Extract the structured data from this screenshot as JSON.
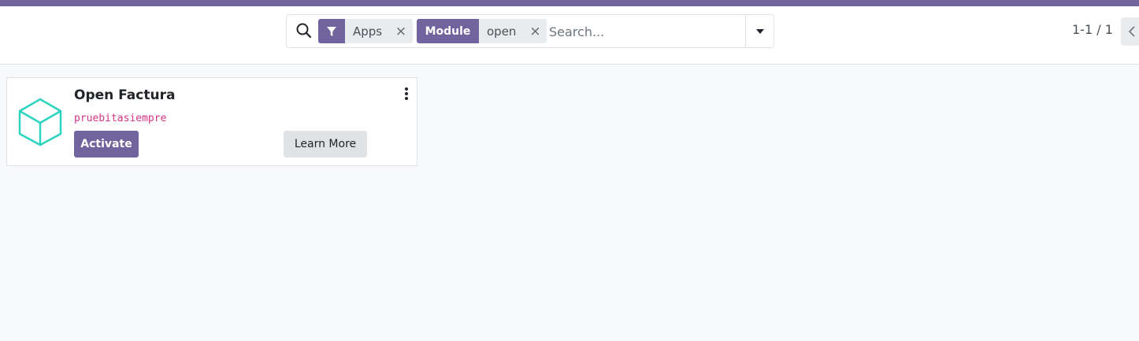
{
  "search": {
    "facets": [
      {
        "type": "filter",
        "icon": "filter-icon",
        "value": "Apps"
      },
      {
        "type": "field",
        "label": "Module",
        "value": "open"
      }
    ],
    "placeholder": "Search...",
    "remove_icon": "×"
  },
  "pager": {
    "value": "1-1 / 1"
  },
  "card": {
    "title": "Open Factura",
    "technical_name": "pruebitasiempre",
    "activate_label": "Activate",
    "learn_more_label": "Learn More",
    "icon": "cube-icon"
  },
  "colors": {
    "brand": "#71639e",
    "module_icon": "#2cd3be",
    "technical_name": "#d63384"
  }
}
